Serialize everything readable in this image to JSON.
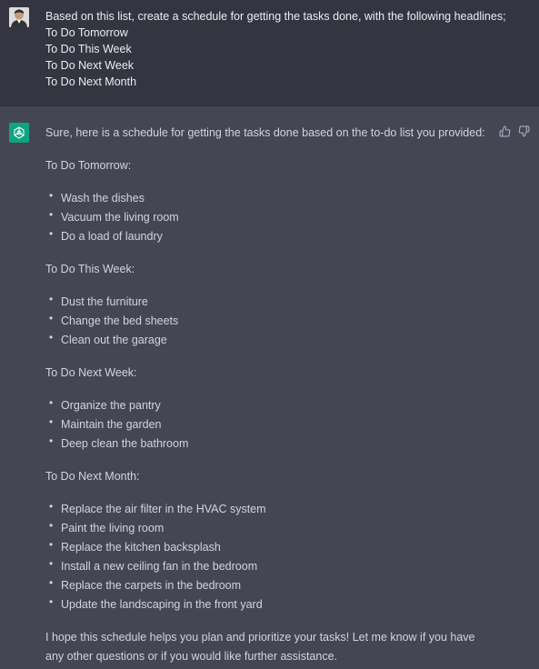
{
  "user_message": {
    "avatar_icon": "user-avatar-photo",
    "lines": [
      "Based on this list, create a schedule for getting the tasks done, with the following headlines;",
      "To Do Tomorrow",
      "To Do This Week",
      "To Do Next Week",
      "To Do Next Month"
    ]
  },
  "assistant_message": {
    "logo_icon": "chatgpt-logo-icon",
    "accent_color": "#10a37f",
    "intro": "Sure, here is a schedule for getting the tasks done based on the to-do list you provided:",
    "sections": [
      {
        "heading": "To Do Tomorrow:",
        "items": [
          "Wash the dishes",
          "Vacuum the living room",
          "Do a load of laundry"
        ]
      },
      {
        "heading": "To Do This Week:",
        "items": [
          "Dust the furniture",
          "Change the bed sheets",
          "Clean out the garage"
        ]
      },
      {
        "heading": "To Do Next Week:",
        "items": [
          "Organize the pantry",
          "Maintain the garden",
          "Deep clean the bathroom"
        ]
      },
      {
        "heading": "To Do Next Month:",
        "items": [
          "Replace the air filter in the HVAC system",
          "Paint the living room",
          "Replace the kitchen backsplash",
          "Install a new ceiling fan in the bedroom",
          "Replace the carpets in the bedroom",
          "Update the landscaping in the front yard"
        ]
      }
    ],
    "closing": "I hope this schedule helps you plan and prioritize your tasks! Let me know if you have any other questions or if you would like further assistance.",
    "feedback_icons": [
      "thumbs-up-icon",
      "thumbs-down-icon"
    ]
  }
}
